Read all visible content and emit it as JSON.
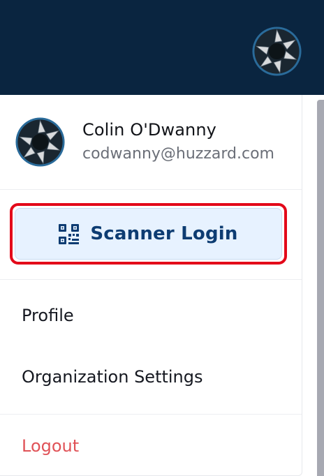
{
  "header": {
    "avatar_icon": "user-avatar-icon"
  },
  "user": {
    "name": "Colin O'Dwanny",
    "email": "codwanny@huzzard.com",
    "avatar_icon": "user-avatar-icon"
  },
  "scanner_login": {
    "label": "Scanner Login",
    "icon": "qr-code-icon"
  },
  "menu": {
    "profile": "Profile",
    "organization_settings": "Organization Settings",
    "logout": "Logout"
  },
  "colors": {
    "header_bg": "#0a2540",
    "highlight_border": "#e3091a",
    "scanner_bg": "#e7f2ff",
    "scanner_text": "#0d3c72",
    "logout_text": "#e05257"
  }
}
